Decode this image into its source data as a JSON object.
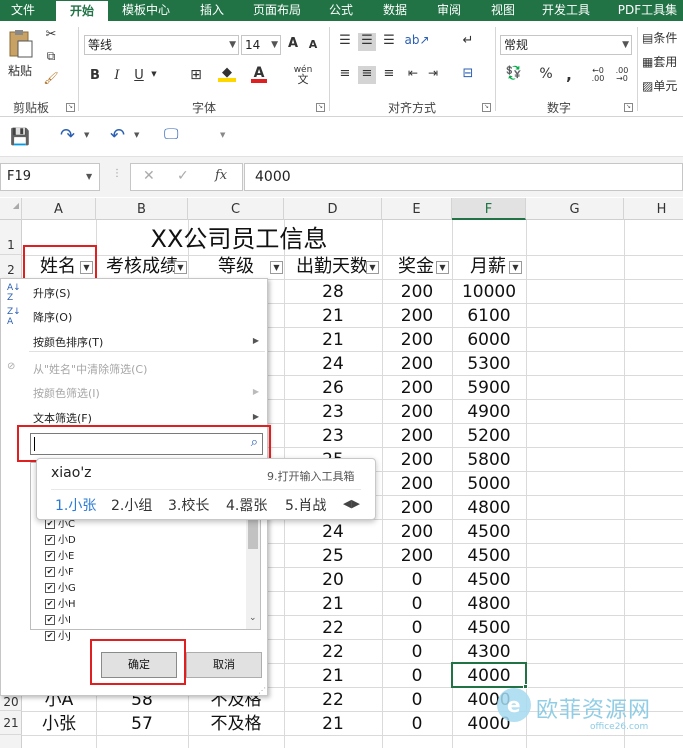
{
  "tabs": [
    "文件",
    "开始",
    "模板中心",
    "插入",
    "页面布局",
    "公式",
    "数据",
    "审阅",
    "视图",
    "开发工具",
    "PDF工具集"
  ],
  "ribbon": {
    "paste_label": "粘贴",
    "clipboard_label": "剪贴板",
    "font_name": "等线",
    "font_size": "14",
    "font_group_label": "字体",
    "align_group_label": "对齐方式",
    "number_format": "常规",
    "number_group_label": "数字",
    "style_items": [
      "条件",
      "套用",
      "单元"
    ],
    "bold": "B",
    "italic": "I",
    "underline": "U",
    "grow": "A",
    "shrink": "A",
    "wen": "wén"
  },
  "formula_bar": {
    "name_box": "F19",
    "fx": "fx",
    "value": "4000",
    "cancel": "✕",
    "enter": "✓"
  },
  "columns": [
    "A",
    "B",
    "C",
    "D",
    "E",
    "F",
    "G",
    "H"
  ],
  "rows": [
    "1",
    "2",
    "3",
    "4",
    "5",
    "6",
    "7",
    "8",
    "9",
    "10",
    "11",
    "12",
    "13",
    "14",
    "15",
    "16",
    "17",
    "18",
    "19",
    "20",
    "21"
  ],
  "sheet": {
    "title": "XX公司员工信息",
    "headers": [
      "姓名",
      "考核成绩",
      "等级",
      "出勤天数",
      "奖金",
      "月薪"
    ],
    "attendance": [
      "28",
      "21",
      "21",
      "24",
      "26",
      "23",
      "23",
      "25",
      "25",
      "21",
      "24",
      "25",
      "20",
      "21",
      "22",
      "22",
      "21",
      "22",
      "21"
    ],
    "bonus": [
      "200",
      "200",
      "200",
      "200",
      "200",
      "200",
      "200",
      "200",
      "200",
      "200",
      "200",
      "200",
      "0",
      "0",
      "0",
      "0",
      "0",
      "0",
      "0"
    ],
    "salary": [
      "10000",
      "6100",
      "6000",
      "5300",
      "5900",
      "4900",
      "5200",
      "5800",
      "5000",
      "4800",
      "4500",
      "4500",
      "4500",
      "4800",
      "4500",
      "4300",
      "4000",
      "4000",
      "4000"
    ],
    "row20": {
      "name": "小A",
      "score": "58",
      "grade": "不及格"
    },
    "row21": {
      "name": "小张",
      "score": "57",
      "grade": "不及格"
    }
  },
  "filter_menu": {
    "sort_asc": "升序(S)",
    "sort_desc": "降序(O)",
    "sort_color": "按颜色排序(T)",
    "clear_filter": "从\"姓名\"中清除筛选(C)",
    "filter_color": "按颜色筛选(I)",
    "text_filter": "文本筛选(F)",
    "search_placeholder": "",
    "items": [
      "小C",
      "小D",
      "小E",
      "小F",
      "小G",
      "小H",
      "小I",
      "小J"
    ],
    "ok": "确定",
    "cancel": "取消"
  },
  "ime": {
    "composition": "xiao'z",
    "hint": "9.打开输入工具箱",
    "candidates": [
      "1.小张",
      "2.小组",
      "3.校长",
      "4.嚣张",
      "5.肖战"
    ]
  },
  "watermark": {
    "text": "欧菲资源网",
    "url": "office26.com"
  },
  "colors": {
    "excel_green": "#217346",
    "highlight_red": "#e02020",
    "ime_blue": "#2b7bd6"
  }
}
